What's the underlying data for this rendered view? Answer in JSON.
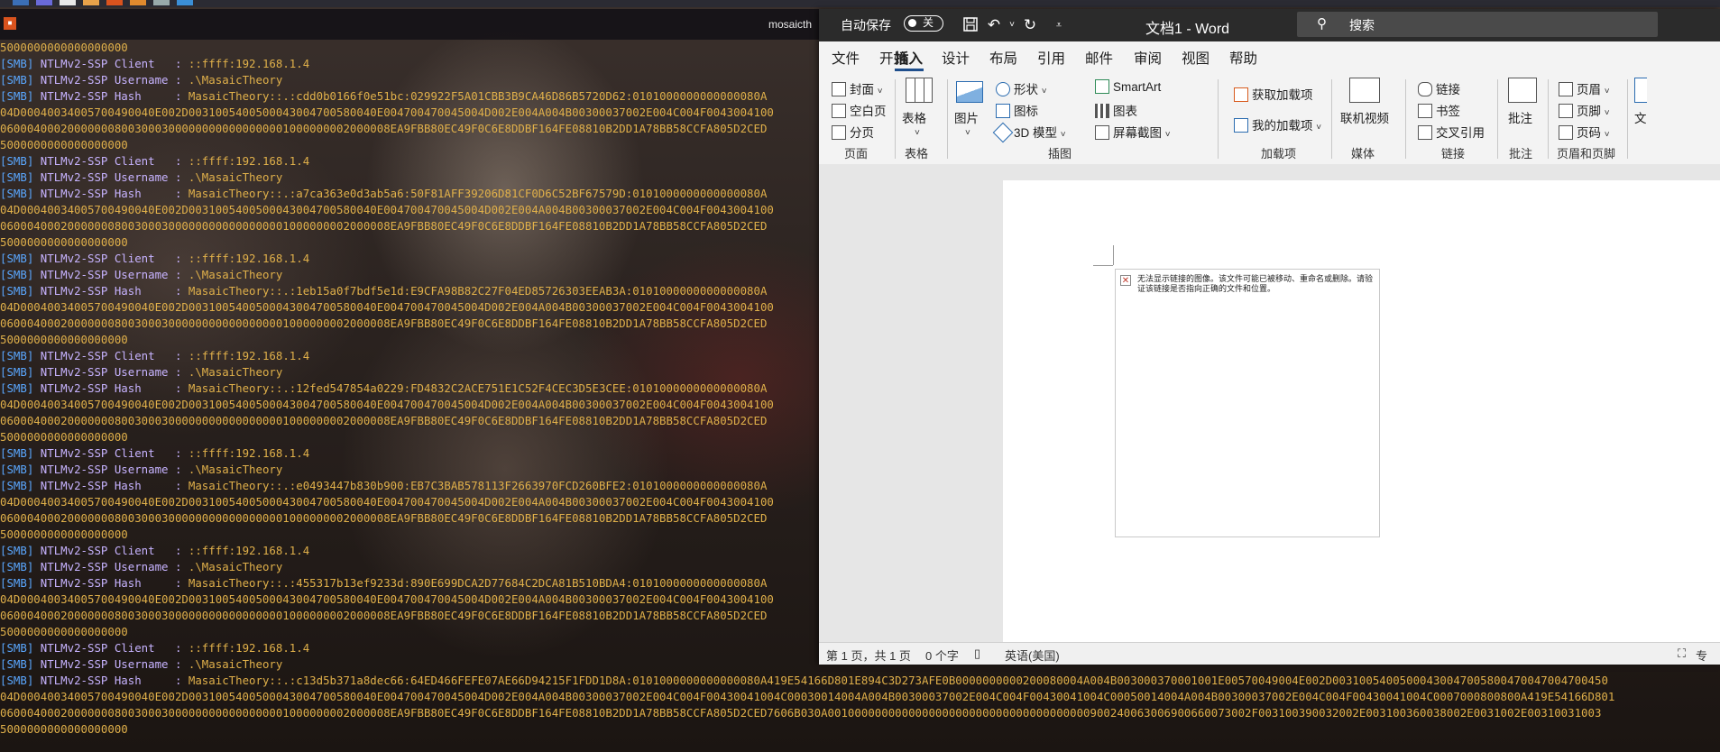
{
  "terminal": {
    "title": "mosaicth",
    "lines": [
      {
        "type": "hex",
        "text": "5000000000000000000"
      },
      {
        "type": "kv",
        "tag": "[SMB]",
        "label": " NTLMv2-SSP Client   : ",
        "value": "::ffff:192.168.1.4"
      },
      {
        "type": "kv",
        "tag": "[SMB]",
        "label": " NTLMv2-SSP Username : ",
        "value": ".\\MasaicTheory"
      },
      {
        "type": "kv",
        "tag": "[SMB]",
        "label": " NTLMv2-SSP Hash     : ",
        "value": "MasaicTheory::.:cdd0b0166f0e51bc:029922F5A01CBB3B9CA46D86B5720D62:0101000000000000080A"
      },
      {
        "type": "hex",
        "text": "04D00040034005700490040E002D0031005400500043004700580040E004700470045004D002E004A004B00300037002E004C004F0043004100"
      },
      {
        "type": "hex",
        "text": "0600040002000000080030003000000000000000001000000002000008EA9FBB80EC49F0C6E8DDBF164FE08810B2DD1A78BB58CCFA805D2CED"
      },
      {
        "type": "hex",
        "text": "5000000000000000000"
      },
      {
        "type": "kv",
        "tag": "[SMB]",
        "label": " NTLMv2-SSP Client   : ",
        "value": "::ffff:192.168.1.4"
      },
      {
        "type": "kv",
        "tag": "[SMB]",
        "label": " NTLMv2-SSP Username : ",
        "value": ".\\MasaicTheory"
      },
      {
        "type": "kv",
        "tag": "[SMB]",
        "label": " NTLMv2-SSP Hash     : ",
        "value": "MasaicTheory::.:a7ca363e0d3ab5a6:50F81AFF39206D81CF0D6C52BF67579D:0101000000000000080A"
      },
      {
        "type": "hex",
        "text": "04D00040034005700490040E002D0031005400500043004700580040E004700470045004D002E004A004B00300037002E004C004F0043004100"
      },
      {
        "type": "hex",
        "text": "0600040002000000080030003000000000000000001000000002000008EA9FBB80EC49F0C6E8DDBF164FE08810B2DD1A78BB58CCFA805D2CED"
      },
      {
        "type": "hex",
        "text": "5000000000000000000"
      },
      {
        "type": "kv",
        "tag": "[SMB]",
        "label": " NTLMv2-SSP Client   : ",
        "value": "::ffff:192.168.1.4"
      },
      {
        "type": "kv",
        "tag": "[SMB]",
        "label": " NTLMv2-SSP Username : ",
        "value": ".\\MasaicTheory"
      },
      {
        "type": "kv",
        "tag": "[SMB]",
        "label": " NTLMv2-SSP Hash     : ",
        "value": "MasaicTheory::.:1eb15a0f7bdf5e1d:E9CFA98B82C27F04ED85726303EEAB3A:0101000000000000080A"
      },
      {
        "type": "hex",
        "text": "04D00040034005700490040E002D0031005400500043004700580040E004700470045004D002E004A004B00300037002E004C004F0043004100"
      },
      {
        "type": "hex",
        "text": "0600040002000000080030003000000000000000001000000002000008EA9FBB80EC49F0C6E8DDBF164FE08810B2DD1A78BB58CCFA805D2CED"
      },
      {
        "type": "hex",
        "text": "5000000000000000000"
      },
      {
        "type": "kv",
        "tag": "[SMB]",
        "label": " NTLMv2-SSP Client   : ",
        "value": "::ffff:192.168.1.4"
      },
      {
        "type": "kv",
        "tag": "[SMB]",
        "label": " NTLMv2-SSP Username : ",
        "value": ".\\MasaicTheory"
      },
      {
        "type": "kv",
        "tag": "[SMB]",
        "label": " NTLMv2-SSP Hash     : ",
        "value": "MasaicTheory::.:12fed547854a0229:FD4832C2ACE751E1C52F4CEC3D5E3CEE:0101000000000000080A"
      },
      {
        "type": "hex",
        "text": "04D00040034005700490040E002D0031005400500043004700580040E004700470045004D002E004A004B00300037002E004C004F0043004100"
      },
      {
        "type": "hex",
        "text": "0600040002000000080030003000000000000000001000000002000008EA9FBB80EC49F0C6E8DDBF164FE08810B2DD1A78BB58CCFA805D2CED"
      },
      {
        "type": "hex",
        "text": "5000000000000000000"
      },
      {
        "type": "kv",
        "tag": "[SMB]",
        "label": " NTLMv2-SSP Client   : ",
        "value": "::ffff:192.168.1.4"
      },
      {
        "type": "kv",
        "tag": "[SMB]",
        "label": " NTLMv2-SSP Username : ",
        "value": ".\\MasaicTheory"
      },
      {
        "type": "kv",
        "tag": "[SMB]",
        "label": " NTLMv2-SSP Hash     : ",
        "value": "MasaicTheory::.:e0493447b830b900:EB7C3BAB578113F2663970FCD260BFE2:0101000000000000080A"
      },
      {
        "type": "hex",
        "text": "04D00040034005700490040E002D0031005400500043004700580040E004700470045004D002E004A004B00300037002E004C004F0043004100"
      },
      {
        "type": "hex",
        "text": "0600040002000000080030003000000000000000001000000002000008EA9FBB80EC49F0C6E8DDBF164FE08810B2DD1A78BB58CCFA805D2CED"
      },
      {
        "type": "hex",
        "text": "5000000000000000000"
      },
      {
        "type": "kv",
        "tag": "[SMB]",
        "label": " NTLMv2-SSP Client   : ",
        "value": "::ffff:192.168.1.4"
      },
      {
        "type": "kv",
        "tag": "[SMB]",
        "label": " NTLMv2-SSP Username : ",
        "value": ".\\MasaicTheory"
      },
      {
        "type": "kv",
        "tag": "[SMB]",
        "label": " NTLMv2-SSP Hash     : ",
        "value": "MasaicTheory::.:455317b13ef9233d:890E699DCA2D77684C2DCA81B510BDA4:0101000000000000080A"
      },
      {
        "type": "hex",
        "text": "04D00040034005700490040E002D0031005400500043004700580040E004700470045004D002E004A004B00300037002E004C004F0043004100"
      },
      {
        "type": "hex",
        "text": "0600040002000000080030003000000000000000001000000002000008EA9FBB80EC49F0C6E8DDBF164FE08810B2DD1A78BB58CCFA805D2CED"
      },
      {
        "type": "hex",
        "text": "5000000000000000000"
      },
      {
        "type": "kv",
        "tag": "[SMB]",
        "label": " NTLMv2-SSP Client   : ",
        "value": "::ffff:192.168.1.4"
      },
      {
        "type": "kv",
        "tag": "[SMB]",
        "label": " NTLMv2-SSP Username : ",
        "value": ".\\MasaicTheory"
      },
      {
        "type": "kv",
        "tag": "[SMB]",
        "label": " NTLMv2-SSP Hash     : ",
        "value": "MasaicTheory::.:c13d5b371a8dec66:64ED466FEFE07AE66D94215F1FDD1D8A:0101000000000000080A419E54166D801E894C3D273AFE0B0000000000200080004A004B003000370001001E00570049004E002D00310054005000430047005800470047004700450"
      },
      {
        "type": "hex",
        "text": "04D00040034005700490040E002D0031005400500043004700580040E004700470045004D002E004A004B00300037002E004C004F00430041004C00030014004A004B00300037002E004C004F00430041004C00050014004A004B00300037002E004C004F00430041004C0007000800800A419E54166D801"
      },
      {
        "type": "hex",
        "text": "0600040002000000080030003000000000000000001000000002000008EA9FBB80EC49F0C6E8DDBF164FE08810B2DD1A78BB58CCFA805D2CED7606B030A001000000000000000000000000000000000000900240063006900660073002F003100390032002E003100360038002E0031002E00310031003"
      },
      {
        "type": "hex",
        "text": "5000000000000000000"
      }
    ]
  },
  "word": {
    "autosave_label": "自动保存",
    "autosave_state": "关",
    "doc_title": "文档1  -  Word",
    "search_placeholder": "搜索",
    "tabs": [
      "文件",
      "开始",
      "插入",
      "设计",
      "布局",
      "引用",
      "邮件",
      "审阅",
      "视图",
      "帮助"
    ],
    "ribbon": {
      "pages_group": {
        "cover": "封面",
        "blank": "空白页",
        "break": "分页",
        "label": "页面"
      },
      "table_group": {
        "table": "表格",
        "label": "表格"
      },
      "illus_group": {
        "pictures": "图片",
        "shapes": "形状",
        "icons": "图标",
        "model3d": "3D 模型",
        "smartart": "SmartArt",
        "chart": "图表",
        "screenshot": "屏幕截图",
        "label": "插图"
      },
      "addin_group": {
        "get": "获取加载项",
        "my": "我的加载项",
        "label": "加载项"
      },
      "media_group": {
        "video": "联机视频",
        "label": "媒体"
      },
      "links_group": {
        "link": "链接",
        "bookmark": "书签",
        "crossref": "交叉引用",
        "label": "链接"
      },
      "comment_group": {
        "comment": "批注",
        "label": "批注"
      },
      "hf_group": {
        "header": "页眉",
        "footer": "页脚",
        "pagenum": "页码",
        "label": "页眉和页脚"
      },
      "text_partial": "文"
    },
    "broken_image_text": "无法显示链接的图像。该文件可能已被移动、重命名或删除。请验证该链接是否指向正确的文件和位置。",
    "status": {
      "page": "第 1 页，共 1 页",
      "words": "0 个字",
      "lang": "英语(美国)",
      "focus": "专"
    }
  },
  "colors": {
    "tag": "#5aa7ff",
    "label": "#c7b3ff",
    "value": "#e0b04a",
    "word_title": "#2b2b2b",
    "accent": "#1e4e8c"
  }
}
